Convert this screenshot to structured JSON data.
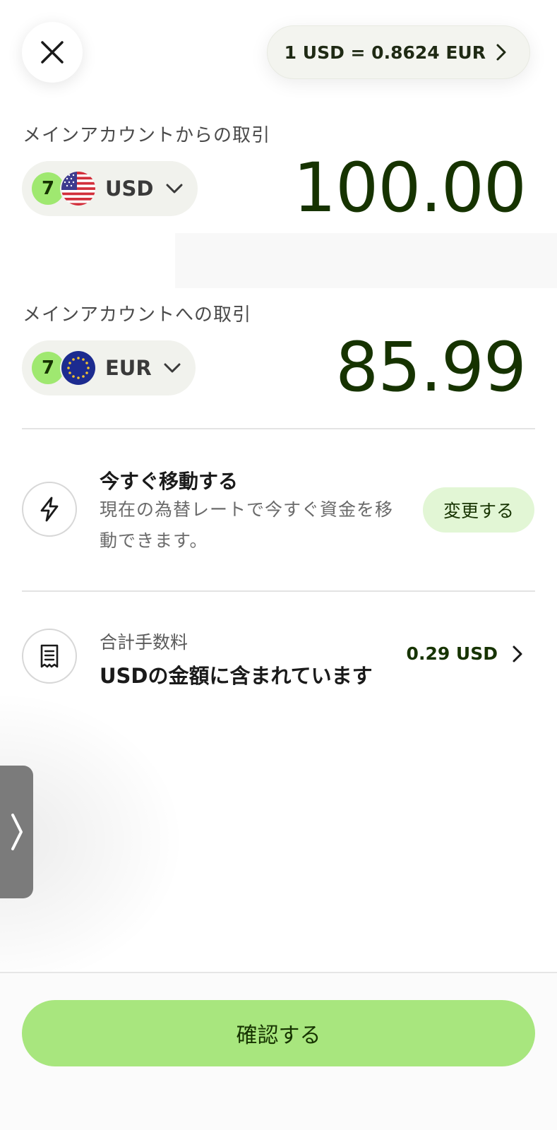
{
  "header": {
    "rate_label": "1 USD = 0.8624 EUR"
  },
  "from": {
    "label": "メインアカウントからの取引",
    "currency": "USD",
    "amount": "100.00"
  },
  "to": {
    "label": "メインアカウントへの取引",
    "currency": "EUR",
    "amount": "85.99"
  },
  "transfer_now": {
    "title": "今すぐ移動する",
    "description": "現在の為替レートで今すぐ資金を移動できます。",
    "change_label": "変更する"
  },
  "fees": {
    "label": "合計手数料",
    "title": "USDの金額に含まれています",
    "amount": "0.29 USD"
  },
  "footer": {
    "confirm_label": "確認する"
  },
  "colors": {
    "brand_green": "#9fe870",
    "dark_green": "#163300",
    "button_green": "#a8e67e",
    "soft_green": "#e2f6d5"
  },
  "icons": {
    "close": "close-icon",
    "rate_chevron": "chevron-right-icon",
    "currency_chevron": "chevron-down-icon",
    "bolt": "lightning-icon",
    "receipt": "receipt-icon",
    "fee_chevron": "chevron-right-icon",
    "side_handle": "chevron-right-icon"
  }
}
